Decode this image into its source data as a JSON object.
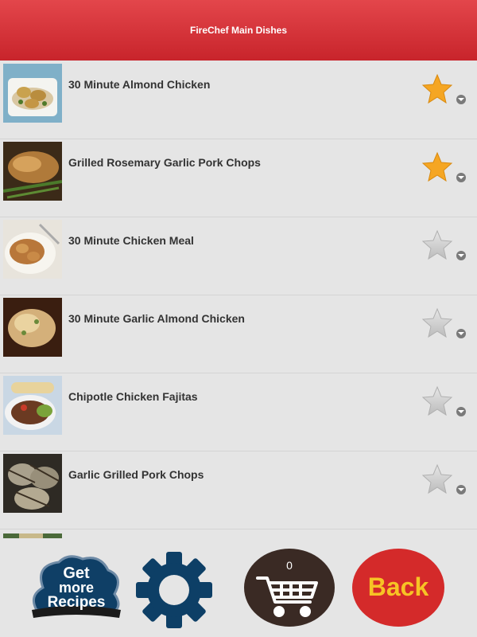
{
  "header": {
    "title": "FireChef Main Dishes"
  },
  "recipes": [
    {
      "title": "30 Minute Almond Chicken",
      "favorite": true
    },
    {
      "title": "Grilled Rosemary Garlic Pork Chops",
      "favorite": true
    },
    {
      "title": "30 Minute Chicken Meal",
      "favorite": false
    },
    {
      "title": "30 Minute Garlic Almond Chicken",
      "favorite": false
    },
    {
      "title": "Chipotle Chicken Fajitas",
      "favorite": false
    },
    {
      "title": "Garlic Grilled Pork Chops",
      "favorite": false
    }
  ],
  "toolbar": {
    "get_more_line1": "Get",
    "get_more_line2": "more",
    "get_more_line3": "Recipes",
    "cart_count": "0",
    "back_label": "Back"
  },
  "colors": {
    "header": "#d8343b",
    "star_active": "#f5a623",
    "star_inactive": "#cfcfcf",
    "settings_gear": "#0d3f66",
    "cart_bg": "#3a2a24",
    "back_bg": "#d42a2a",
    "back_text": "#f7c325"
  },
  "icons": [
    "star-icon",
    "chevron-down-icon",
    "gear-icon",
    "cart-icon"
  ]
}
